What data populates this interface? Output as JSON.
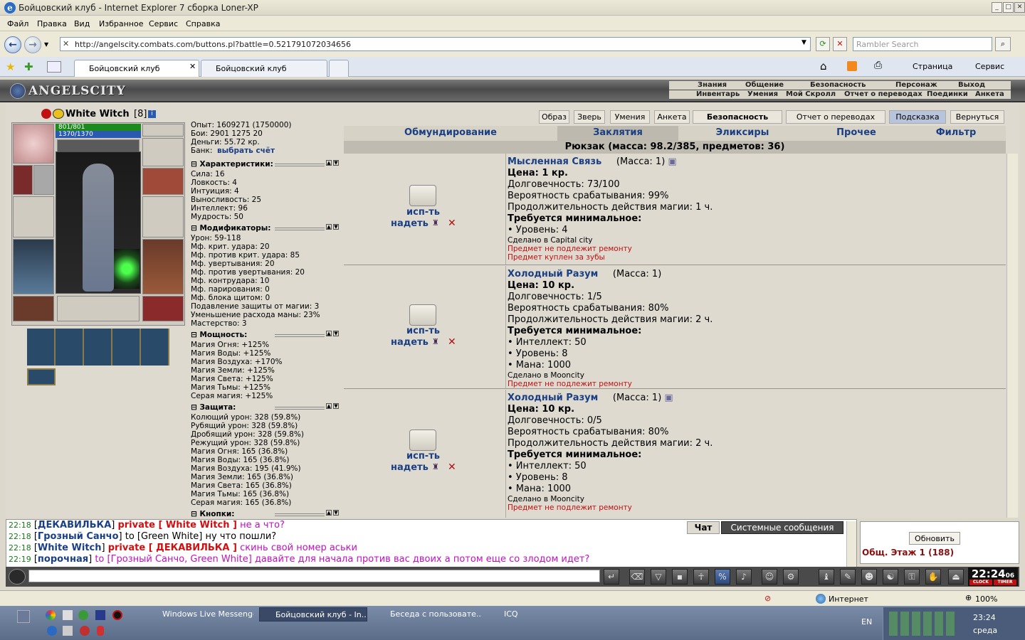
{
  "window": {
    "title": "Бойцовский клуб - Internet Explorer 7 сборка Loner-XP"
  },
  "menu": [
    "Файл",
    "Правка",
    "Вид",
    "Избранное",
    "Сервис",
    "Справка"
  ],
  "address": {
    "url": "http://angelscity.combats.com/buttons.pl?battle=0.521791072034656",
    "search_placeholder": "Rambler Search"
  },
  "browser_tabs": [
    {
      "label": "Бойцовский клуб"
    },
    {
      "label": "Бойцовский клуб"
    }
  ],
  "command_bar": {
    "page": "Страница",
    "tools": "Сервис"
  },
  "game": {
    "logo": "ANGELSCITY",
    "nav_row1": [
      "Знания",
      "Общение",
      "Безопасность",
      "Персонаж",
      "Выход"
    ],
    "nav_row2": [
      "Инвентарь",
      "Умения",
      "Мой Скролл",
      "Отчет о переводах",
      "Поединки",
      "Анкета"
    ]
  },
  "character": {
    "name": "White Witch",
    "level": "[8]",
    "hp": "801/801",
    "mana": "1370/1370"
  },
  "stats_top": {
    "exp": "Опыт: 1609271 (1750000)",
    "fights": "Бои: 2901  1275  20",
    "money": "Деньги: 55.72 кр.",
    "bank_label": "Банк:",
    "bank_link": "выбрать счёт"
  },
  "sections": {
    "characteristics": {
      "title": "Характеристики:",
      "lines": [
        "Сила: 16",
        "Ловкость: 4",
        "Интуиция: 4",
        "Выносливость: 25",
        "Интеллект: 96",
        "Мудрость: 50"
      ]
    },
    "modifiers": {
      "title": "Модификаторы:",
      "lines": [
        "Урон: 59-118",
        "Мф. крит. удара: 20",
        "Мф. против крит. удара: 85",
        "Мф. увертывания: 20",
        "Мф. против увертывания: 20",
        "Мф. контрудара: 10",
        "Мф. парирования: 0",
        "Мф. блока щитом: 0",
        "Подавление защиты от магии: 3",
        "Уменьшение расхода маны: 23%",
        "Мастерство: 3"
      ]
    },
    "powers": {
      "title": "Мощность:",
      "lines": [
        "Магия Огня: +125%",
        "Магия Воды: +125%",
        "Магия Воздуха: +170%",
        "Магия Земли: +125%",
        "Магия Света: +125%",
        "Магия Тьмы: +125%",
        "Серая магия: +125%"
      ]
    },
    "defense": {
      "title": "Защита:",
      "lines": [
        "Колющий урон: 328 (59.8%)",
        "Рубящий урон: 328 (59.8%)",
        "Дробящий урон: 328 (59.8%)",
        "Режущий урон: 328 (59.8%)",
        "Магия Огня: 165 (36.8%)",
        "Магия Воды: 165 (36.8%)",
        "Магия Воздуха: 195 (41.9%)",
        "Магия Земли: 165 (36.8%)",
        "Магия Света: 165 (36.8%)",
        "Магия Тьмы: 165 (36.8%)",
        "Серая магия: 165 (36.8%)"
      ]
    },
    "buttons": {
      "title": "Кнопки:"
    }
  },
  "top_buttons": [
    "Образ",
    "Зверь",
    "Умения",
    "Анкета",
    "Безопасность",
    "Отчет о переводах",
    "Подсказка",
    "Вернуться"
  ],
  "categories": [
    "Обмундирование",
    "Заклятия",
    "Эликсиры",
    "Прочее",
    "Фильтр"
  ],
  "backpack": "Рюкзак (масса: 98.2/385, предметов: 36)",
  "item_actions": {
    "use": "исп-ть",
    "wear": "надеть",
    "delete": "✕"
  },
  "items": [
    {
      "name": "Мысленная Связь",
      "mass": "(Масса: 1)",
      "price": "Цена: 1 кр.",
      "lines": [
        "Долговечность: 73/100",
        "Вероятность срабатывания: 99%",
        "Продолжительность действия магии: 1 ч."
      ],
      "req_title": "Требуется минимальное:",
      "reqs": [
        "• Уровень: 4"
      ],
      "made": "Сделано в Capital city",
      "notes": [
        "Предмет не подлежит ремонту",
        "Предмет куплен за зубы"
      ]
    },
    {
      "name": "Холодный Разум",
      "mass": "(Масса: 1)",
      "price": "Цена: 10 кр.",
      "lines": [
        "Долговечность: 1/5",
        "Вероятность срабатывания: 80%",
        "Продолжительность действия магии: 2 ч."
      ],
      "req_title": "Требуется минимальное:",
      "reqs": [
        "• Интеллект: 50",
        "• Уровень: 8",
        "• Мана: 1000"
      ],
      "made": "Сделано в Mooncity",
      "notes": [
        "Предмет не подлежит ремонту"
      ]
    },
    {
      "name": "Холодный Разум",
      "mass": "(Масса: 1)",
      "price": "Цена: 10 кр.",
      "lines": [
        "Долговечность: 0/5",
        "Вероятность срабатывания: 80%",
        "Продолжительность действия магии: 2 ч."
      ],
      "req_title": "Требуется минимальное:",
      "reqs": [
        "• Интеллект: 50",
        "• Уровень: 8",
        "• Мана: 1000"
      ],
      "made": "Сделано в Mooncity",
      "notes": [
        "Предмет не подлежит ремонту"
      ]
    }
  ],
  "chat": {
    "messages": [
      {
        "time": "22:18",
        "nick": "ДЕКАВИЛЬКА",
        "kind": "private",
        "target": "private [ White Witch ]",
        "text": "не а что?"
      },
      {
        "time": "22:18",
        "nick": "Грозный Санчо",
        "kind": "to",
        "target": "to [Green White]",
        "text": "ну что пошли?"
      },
      {
        "time": "22:18",
        "nick": "White Witch",
        "kind": "private",
        "target": "private [ ДЕКАВИЛЬКА ]",
        "text": "скинь свой номер аськи"
      },
      {
        "time": "22:19",
        "nick": "порочная",
        "kind": "pink",
        "target": "to [Грозный Санчо, Green White]",
        "text": "давайте для начала против вас двоих а потом еще со злодом идет?"
      }
    ],
    "tabs": [
      "Чат",
      "Системные сообщения"
    ],
    "refresh": "Обновить",
    "room": "Общ. Этаж 1 (188)"
  },
  "clock": {
    "time": "22:24",
    "sec": "06",
    "label1": "CLOCK",
    "label2": "TIMER"
  },
  "statusbar": {
    "zone": "Интернет",
    "zoom": "100%"
  },
  "taskbar": {
    "tasks": [
      "Windows Live Messenger",
      "Бойцовский клуб - In...",
      "Беседа с пользовате...",
      "ICQ"
    ],
    "lang": "EN",
    "time": "23:24",
    "day": "среда"
  }
}
